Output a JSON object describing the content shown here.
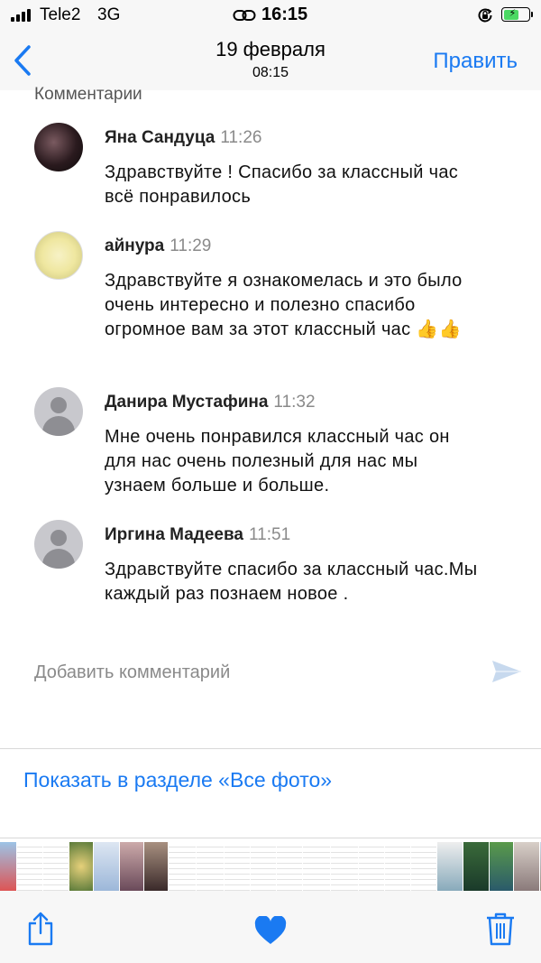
{
  "status_bar": {
    "carrier": "Tele2",
    "network": "3G",
    "time": "16:15",
    "icons": [
      "signal-icon",
      "link-icon",
      "orientation-lock-icon",
      "battery-charging-icon"
    ],
    "battery_color": "#4cd964"
  },
  "nav": {
    "title": "19 февраля",
    "subtitle": "08:15",
    "edit_label": "Править",
    "accent_color": "#1a7af2"
  },
  "comments": {
    "section_title": "Комментарии",
    "items": [
      {
        "author": "Яна Сандуца",
        "time": "11:26",
        "text": "Здравствуйте ! Спасибо за классный час всё понравилось",
        "avatar": "user-photo"
      },
      {
        "author": "айнура",
        "time": "11:29",
        "text": "Здравствуйте я ознакомелась и это было очень интересно и полезно спасибо огромное вам за этот классный час 👍👍",
        "avatar": "user-photo"
      },
      {
        "author": "Данира Мустафина",
        "time": "11:32",
        "text": "Мне очень понравился  классный час он для нас очень полезный для нас мы узнаем  больше и больше.",
        "avatar": "default-person"
      },
      {
        "author": "Иргина Мадеева",
        "time": "11:51",
        "text": "Здравствуйте спасибо за классный час.Мы каждый раз познаем новое .",
        "avatar": "default-person"
      }
    ],
    "add_placeholder": "Добавить комментарий"
  },
  "show_all_link": "Показать в разделе «Все фото»",
  "toolbar": {
    "icons": [
      "share-icon",
      "heart-icon",
      "trash-icon"
    ]
  }
}
